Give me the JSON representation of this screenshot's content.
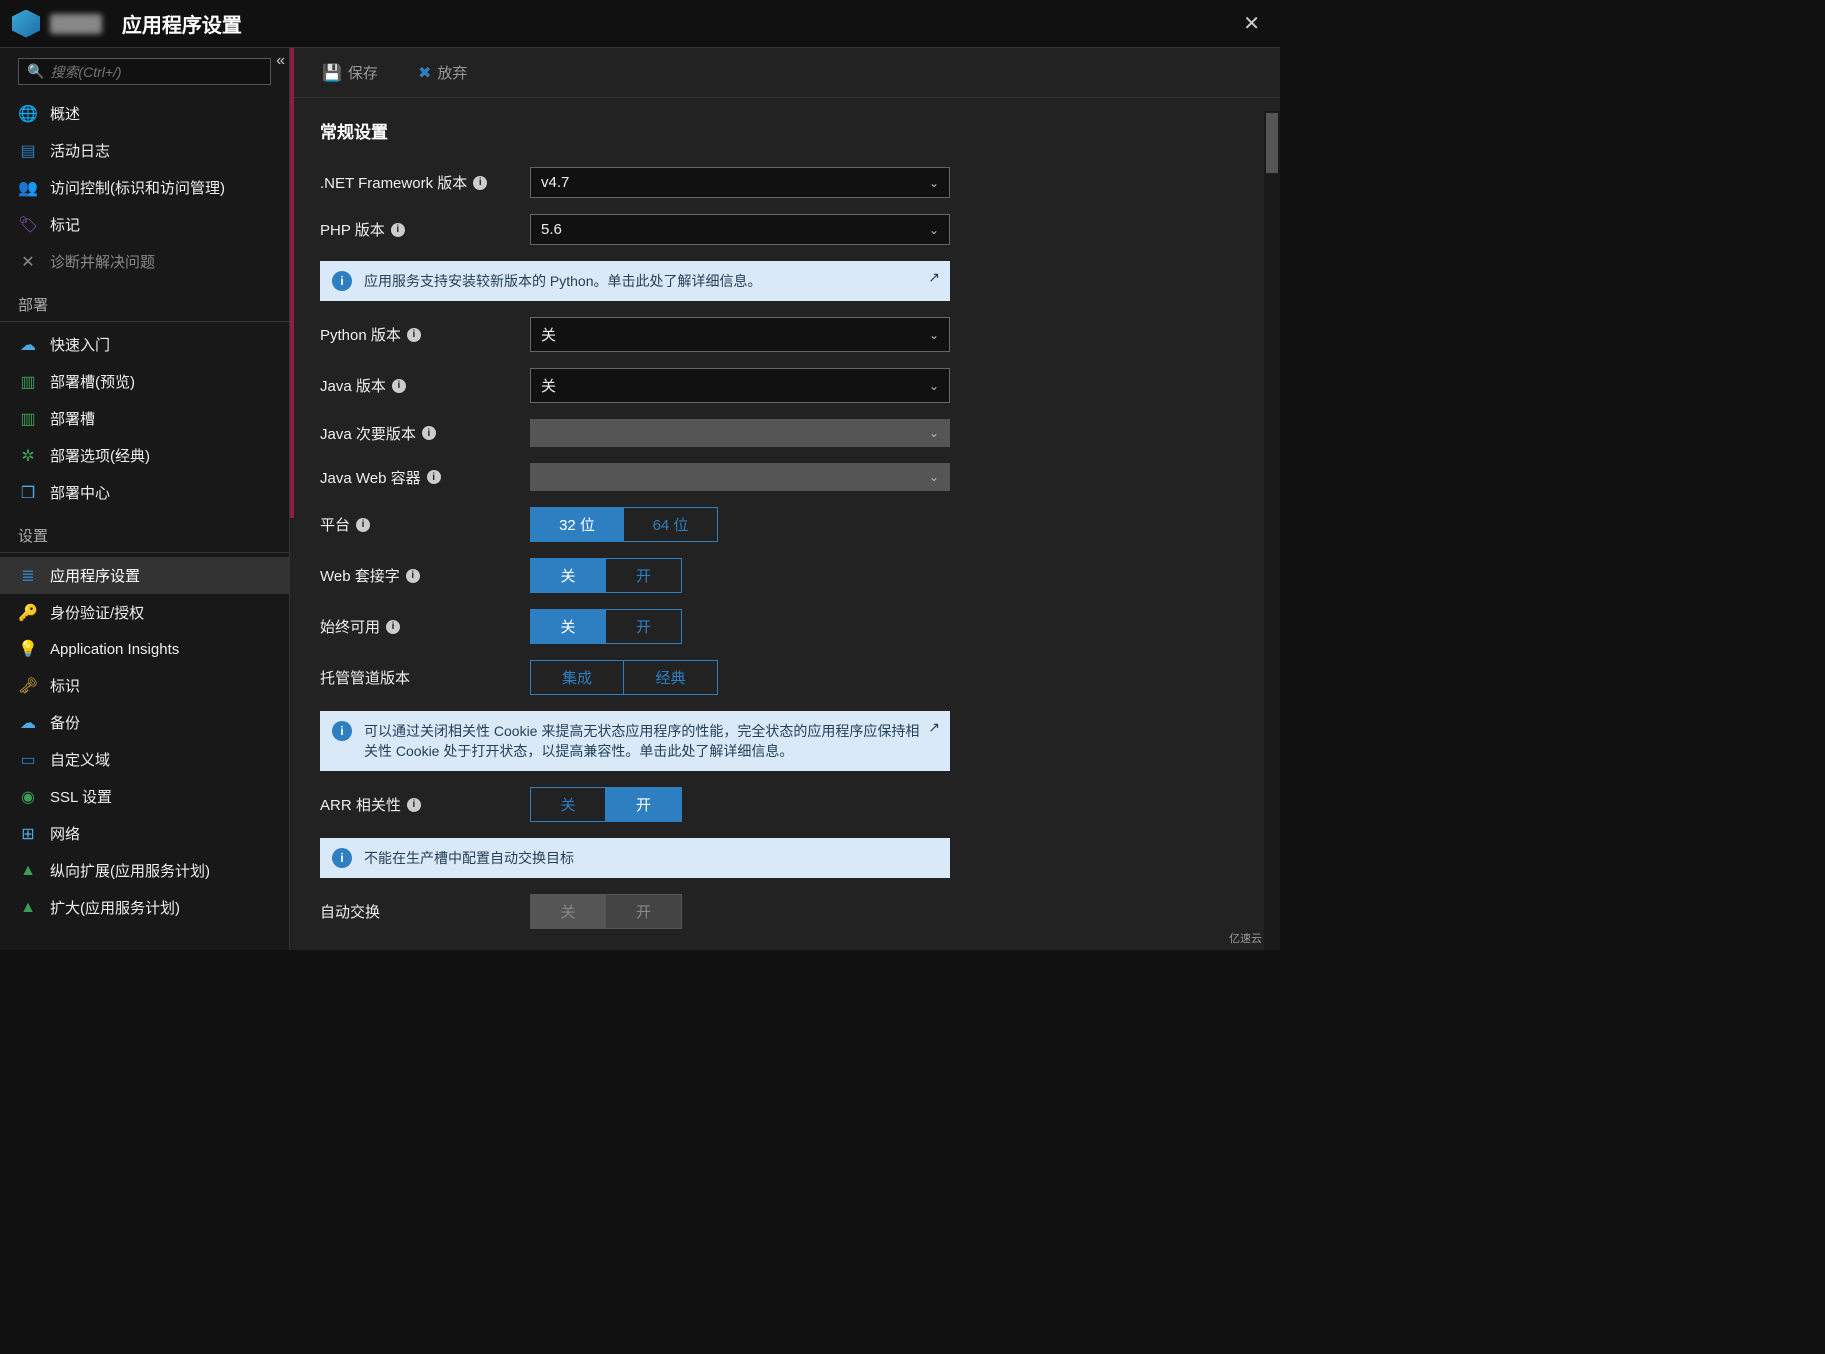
{
  "header": {
    "title": "应用程序设置"
  },
  "search": {
    "placeholder": "搜索(Ctrl+/)"
  },
  "sidebar": {
    "top": [
      {
        "label": "概述",
        "icon": "🌐",
        "cls": "icon-globe"
      },
      {
        "label": "活动日志",
        "icon": "▤",
        "cls": "icon-log"
      },
      {
        "label": "访问控制(标识和访问管理)",
        "icon": "👥",
        "cls": "icon-user"
      },
      {
        "label": "标记",
        "icon": "🏷",
        "cls": "icon-tag"
      },
      {
        "label": "诊断并解决问题",
        "icon": "✕",
        "cls": "dim"
      }
    ],
    "h1": "部署",
    "deploy": [
      {
        "label": "快速入门",
        "icon": "☁",
        "cls": "icon-cloud"
      },
      {
        "label": "部署槽(预览)",
        "icon": "▥",
        "cls": "icon-slot"
      },
      {
        "label": "部署槽",
        "icon": "▥",
        "cls": "icon-slot"
      },
      {
        "label": "部署选项(经典)",
        "icon": "✲",
        "cls": "icon-opt"
      },
      {
        "label": "部署中心",
        "icon": "❒",
        "cls": "icon-center"
      }
    ],
    "h2": "设置",
    "settings": [
      {
        "label": "应用程序设置",
        "icon": "≣",
        "cls": "icon-set",
        "active": true
      },
      {
        "label": "身份验证/授权",
        "icon": "🔑",
        "cls": "icon-key"
      },
      {
        "label": "Application Insights",
        "icon": "💡",
        "cls": "icon-bulb dim"
      },
      {
        "label": "标识",
        "icon": "🗝",
        "cls": "icon-keyy"
      },
      {
        "label": "备份",
        "icon": "☁",
        "cls": "icon-backup"
      },
      {
        "label": "自定义域",
        "icon": "▭",
        "cls": "icon-dom"
      },
      {
        "label": "SSL 设置",
        "icon": "◉",
        "cls": "icon-ssl"
      },
      {
        "label": "网络",
        "icon": "⊞",
        "cls": "icon-net"
      },
      {
        "label": "纵向扩展(应用服务计划)",
        "icon": "▲",
        "cls": "icon-scale"
      },
      {
        "label": "扩大(应用服务计划)",
        "icon": "▲",
        "cls": "icon-scale"
      }
    ]
  },
  "toolbar": {
    "save": "保存",
    "discard": "放弃"
  },
  "section": "常规设置",
  "rows": {
    "net": {
      "label": ".NET Framework 版本",
      "value": "v4.7"
    },
    "php": {
      "label": "PHP 版本",
      "value": "5.6"
    },
    "python": {
      "label": "Python 版本",
      "value": "关"
    },
    "java": {
      "label": "Java 版本",
      "value": "关"
    },
    "javaminor": {
      "label": "Java 次要版本",
      "value": ""
    },
    "javaweb": {
      "label": "Java Web 容器",
      "value": ""
    },
    "platform": {
      "label": "平台",
      "a": "32 位",
      "b": "64 位"
    },
    "ws": {
      "label": "Web 套接字",
      "a": "关",
      "b": "开"
    },
    "always": {
      "label": "始终可用",
      "a": "关",
      "b": "开"
    },
    "pipeline": {
      "label": "托管管道版本",
      "a": "集成",
      "b": "经典"
    },
    "arr": {
      "label": "ARR 相关性",
      "a": "关",
      "b": "开"
    },
    "autoswap": {
      "label": "自动交换",
      "a": "关",
      "b": "开"
    }
  },
  "info": {
    "python": "应用服务支持安装较新版本的 Python。单击此处了解详细信息。",
    "cookie": "可以通过关闭相关性 Cookie 来提高无状态应用程序的性能，完全状态的应用程序应保持相关性 Cookie 处于打开状态，以提高兼容性。单击此处了解详细信息。",
    "swap": "不能在生产槽中配置自动交换目标"
  },
  "watermark": "亿速云"
}
